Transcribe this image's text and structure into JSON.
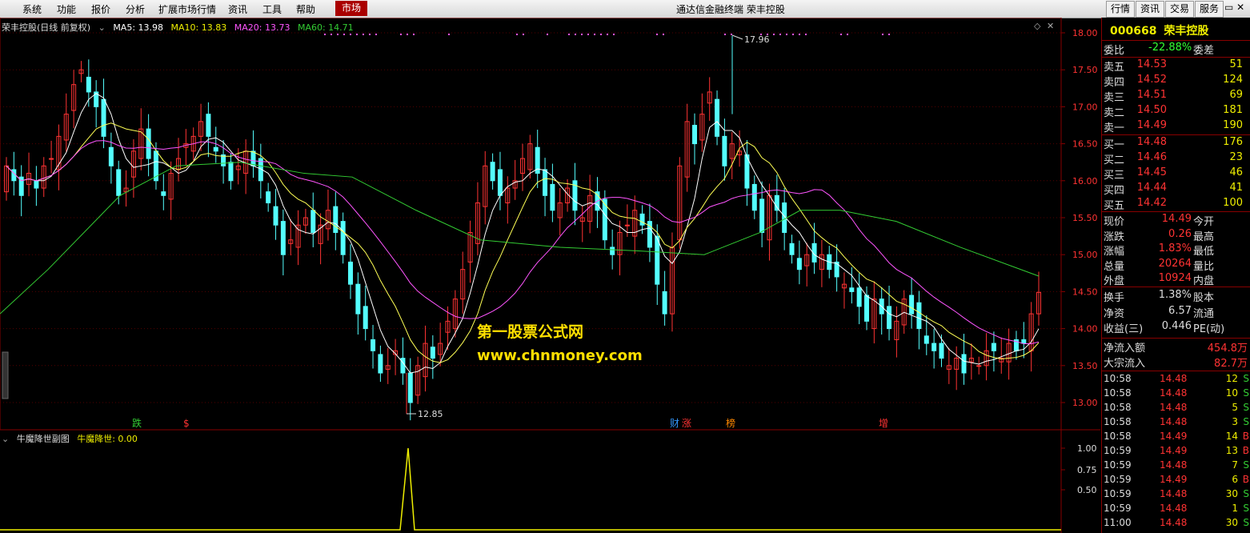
{
  "menubar": {
    "items": [
      "系统",
      "功能",
      "报价",
      "分析",
      "扩展市场行情",
      "资讯",
      "工具",
      "帮助"
    ],
    "active": "市场",
    "title": "通达信金融终端  荣丰控股",
    "right_buttons": [
      "行情",
      "资讯",
      "交易",
      "服务"
    ]
  },
  "chart": {
    "legend_name": "荣丰控股(日线 前复权)",
    "ma5": "MA5: 13.98",
    "ma10": "MA10: 13.83",
    "ma20": "MA20: 13.73",
    "ma60": "MA60: 14.71",
    "y_ticks": [
      "18.00",
      "17.50",
      "17.00",
      "16.50",
      "16.00",
      "15.50",
      "15.00",
      "14.50",
      "14.00",
      "13.50",
      "13.00"
    ],
    "high_label": "17.96",
    "low_label": "12.85",
    "markers": [
      {
        "text": "跌",
        "color": "#3c3"
      },
      {
        "text": "$",
        "color": "#f33"
      },
      {
        "text": "财",
        "color": "#39f"
      },
      {
        "text": "涨",
        "color": "#f33"
      },
      {
        "text": "榜",
        "color": "#f80"
      },
      {
        "text": "增",
        "color": "#f33"
      }
    ],
    "colors": {
      "up": "#ff3333",
      "down": "#54ffff",
      "ma5": "#ffffff",
      "ma10": "#ffff55",
      "ma20": "#ff55ff",
      "ma60": "#33cc33",
      "axis": "#800000"
    }
  },
  "sub_chart": {
    "name": "牛魔降世副图",
    "indicator": "牛魔降世: 0.00",
    "y_ticks": [
      "1.00",
      "0.75",
      "0.50"
    ]
  },
  "watermark": {
    "line1": "第一股票公式网",
    "line2": "www.chnmoney.com"
  },
  "quote": {
    "code": "000668",
    "name": "荣丰控股",
    "weibi_label": "委比",
    "weibi_value": "-22.88%",
    "weicha_label": "委差",
    "asks": [
      {
        "label": "卖五",
        "price": "14.53",
        "vol": "51"
      },
      {
        "label": "卖四",
        "price": "14.52",
        "vol": "124"
      },
      {
        "label": "卖三",
        "price": "14.51",
        "vol": "69"
      },
      {
        "label": "卖二",
        "price": "14.50",
        "vol": "181"
      },
      {
        "label": "卖一",
        "price": "14.49",
        "vol": "190"
      }
    ],
    "bids": [
      {
        "label": "买一",
        "price": "14.48",
        "vol": "176"
      },
      {
        "label": "买二",
        "price": "14.46",
        "vol": "23"
      },
      {
        "label": "买三",
        "price": "14.45",
        "vol": "46"
      },
      {
        "label": "买四",
        "price": "14.44",
        "vol": "41"
      },
      {
        "label": "买五",
        "price": "14.42",
        "vol": "100"
      }
    ],
    "stats": [
      {
        "l1": "现价",
        "v1": "14.49",
        "l2": "今开"
      },
      {
        "l1": "涨跌",
        "v1": "0.26",
        "l2": "最高"
      },
      {
        "l1": "涨幅",
        "v1": "1.83%",
        "l2": "最低"
      },
      {
        "l1": "总量",
        "v1": "20264",
        "l2": "量比"
      },
      {
        "l1": "外盘",
        "v1": "10924",
        "l2": "内盘"
      }
    ],
    "stats2": [
      {
        "l1": "换手",
        "v1": "1.38%",
        "l2": "股本"
      },
      {
        "l1": "净资",
        "v1": "6.57",
        "l2": "流通"
      },
      {
        "l1": "收益(三)",
        "v1": "0.446",
        "l2": "PE(动)"
      }
    ],
    "flow": [
      {
        "label": "净流入额",
        "value": "454.8万"
      },
      {
        "label": "大宗流入",
        "value": "82.7万"
      }
    ],
    "ticks": [
      {
        "time": "10:58",
        "price": "14.48",
        "vol": "12",
        "flag": "S"
      },
      {
        "time": "10:58",
        "price": "14.48",
        "vol": "10",
        "flag": "S"
      },
      {
        "time": "10:58",
        "price": "14.48",
        "vol": "5",
        "flag": "S"
      },
      {
        "time": "10:58",
        "price": "14.48",
        "vol": "3",
        "flag": "S"
      },
      {
        "time": "10:58",
        "price": "14.49",
        "vol": "14",
        "flag": "B"
      },
      {
        "time": "10:59",
        "price": "14.49",
        "vol": "13",
        "flag": "B"
      },
      {
        "time": "10:59",
        "price": "14.48",
        "vol": "7",
        "flag": "S"
      },
      {
        "time": "10:59",
        "price": "14.49",
        "vol": "6",
        "flag": "B"
      },
      {
        "time": "10:59",
        "price": "14.48",
        "vol": "30",
        "flag": "S"
      },
      {
        "time": "10:59",
        "price": "14.48",
        "vol": "1",
        "flag": "S"
      },
      {
        "time": "11:00",
        "price": "14.48",
        "vol": "30",
        "flag": "S"
      }
    ]
  }
}
